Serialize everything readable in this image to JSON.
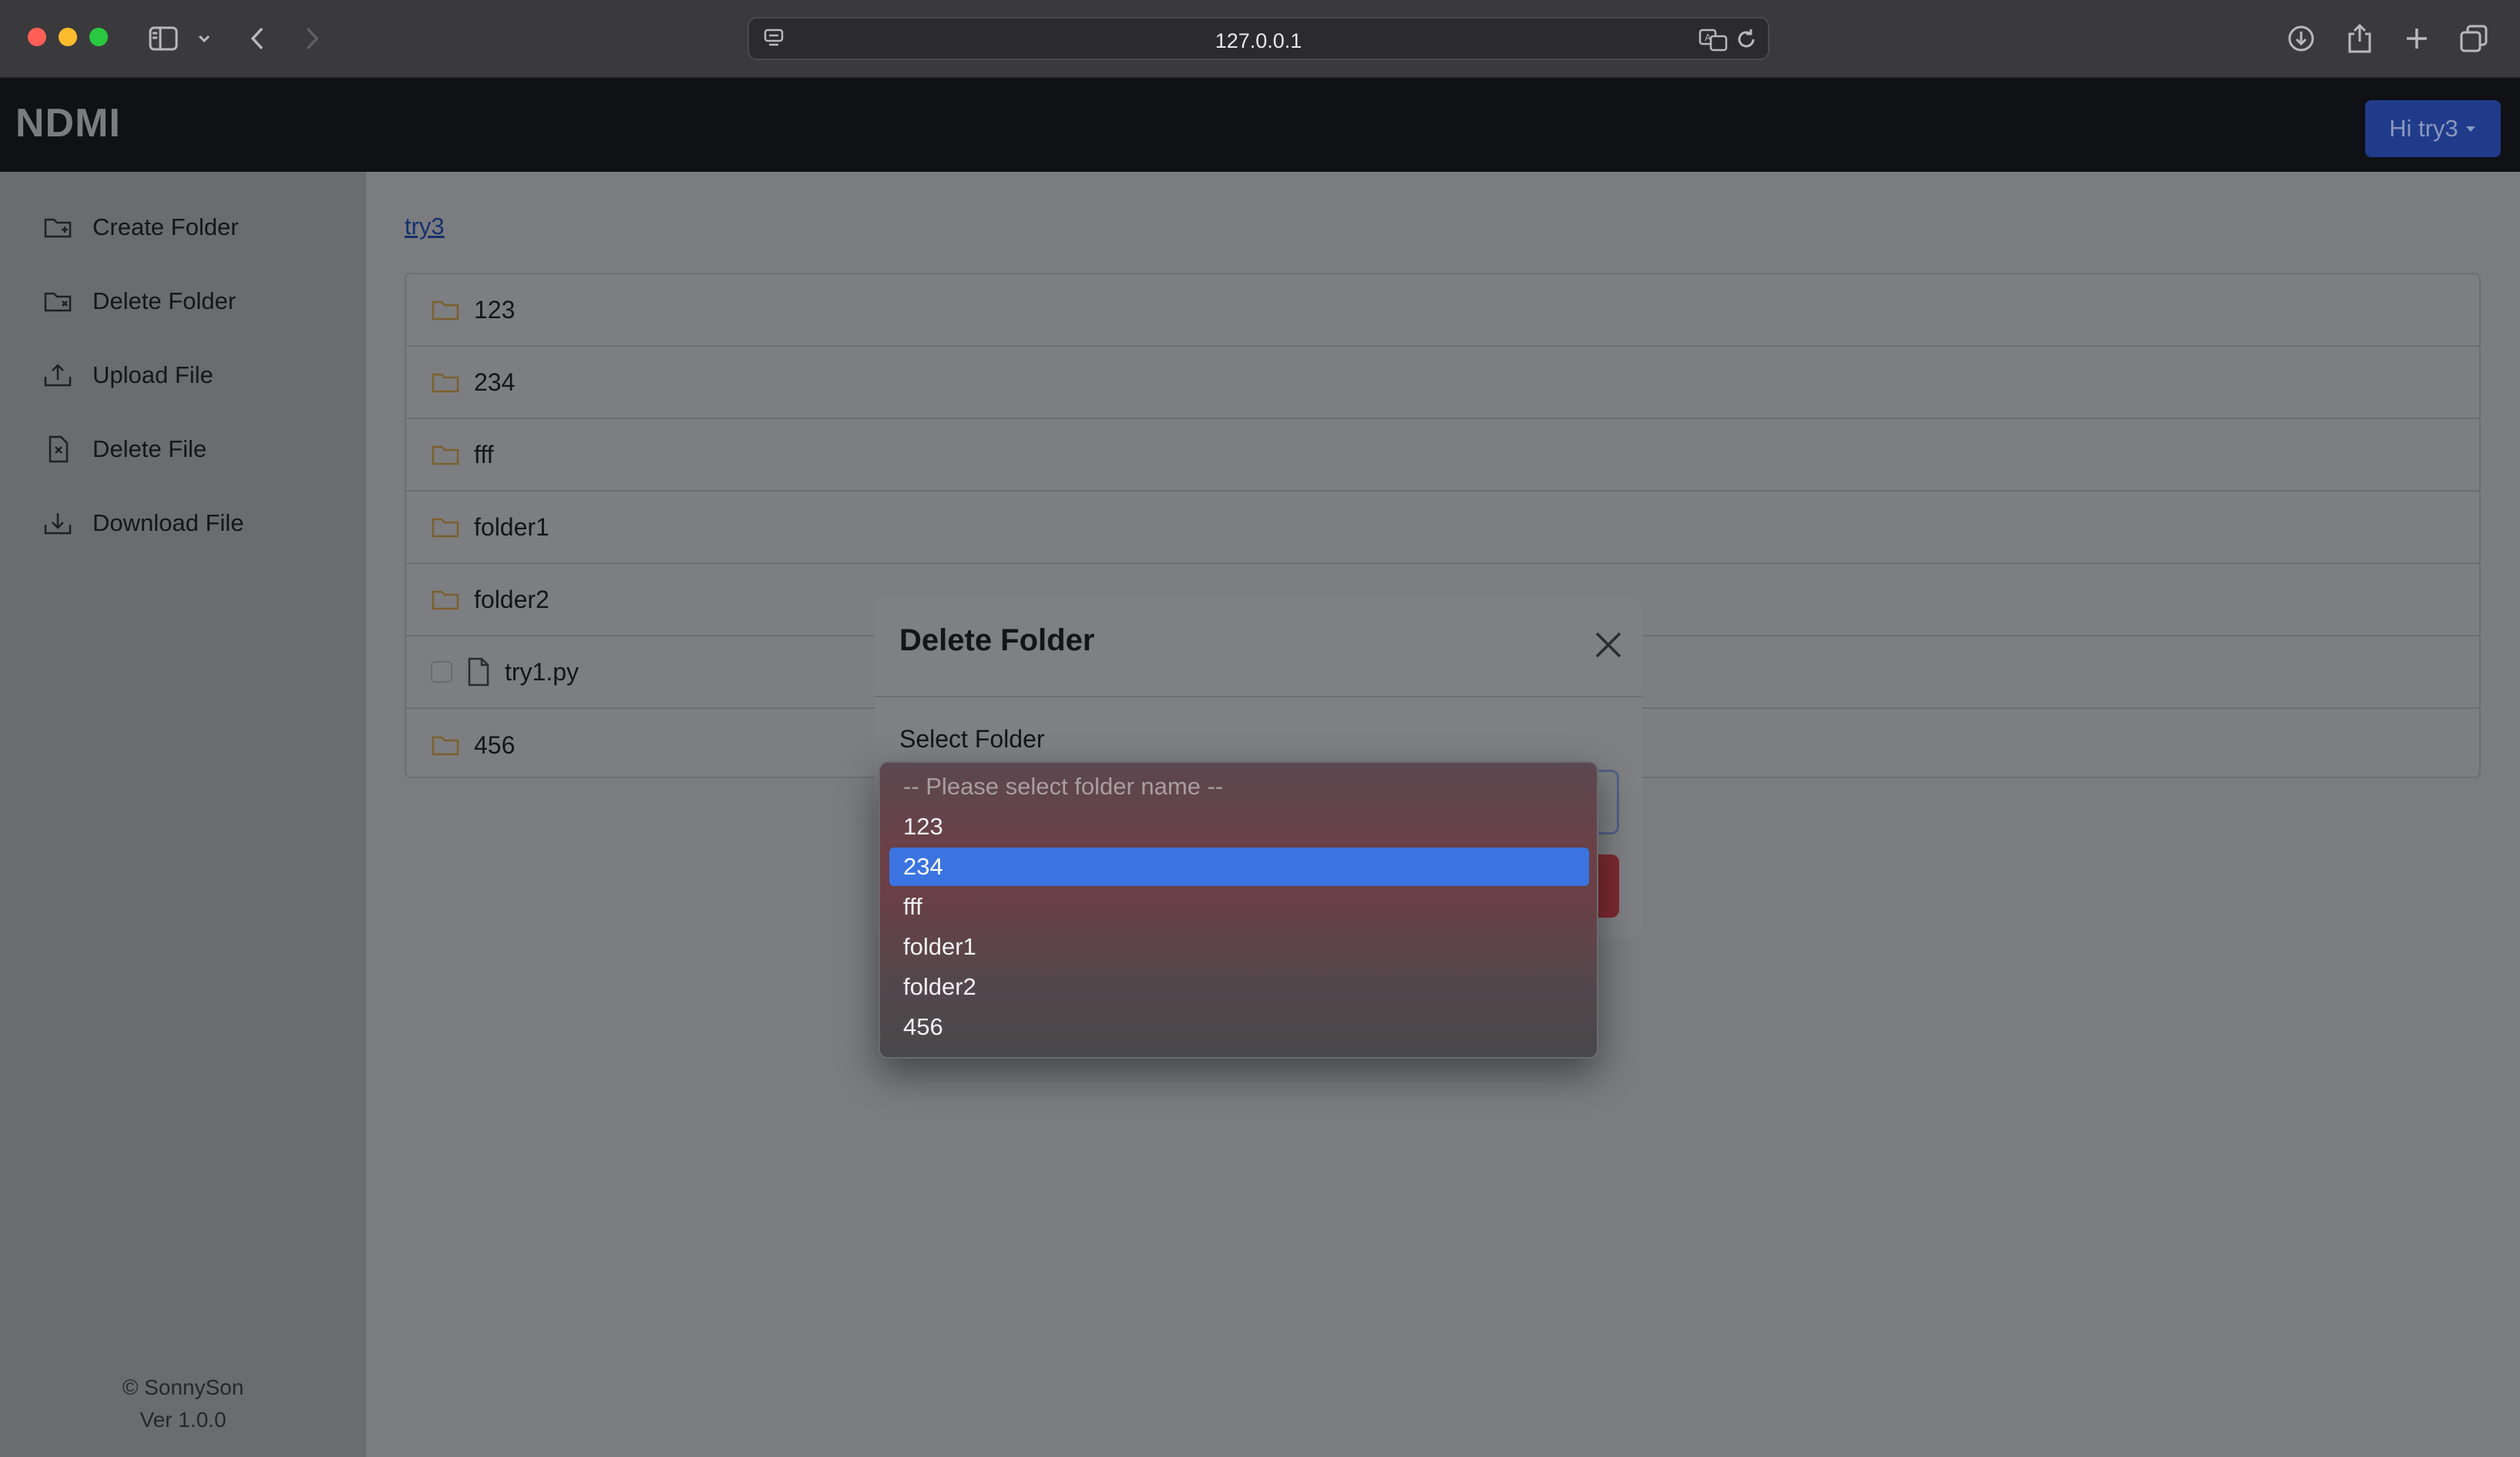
{
  "browser": {
    "url": "127.0.0.1"
  },
  "app": {
    "brand": "NDMI",
    "user_menu_label": "Hi try3"
  },
  "sidebar": {
    "items": [
      {
        "label": "Create Folder",
        "icon": "folder-plus-icon"
      },
      {
        "label": "Delete Folder",
        "icon": "folder-x-icon"
      },
      {
        "label": "Upload File",
        "icon": "upload-icon"
      },
      {
        "label": "Delete File",
        "icon": "file-x-icon"
      },
      {
        "label": "Download File",
        "icon": "download-icon"
      }
    ],
    "footer": {
      "copyright": "© SonnySon",
      "version": "Ver 1.0.0"
    }
  },
  "main": {
    "breadcrumb": "try3",
    "entries": [
      {
        "name": "123",
        "type": "folder"
      },
      {
        "name": "234",
        "type": "folder"
      },
      {
        "name": "fff",
        "type": "folder"
      },
      {
        "name": "folder1",
        "type": "folder"
      },
      {
        "name": "folder2",
        "type": "folder"
      },
      {
        "name": "try1.py",
        "type": "file"
      },
      {
        "name": "456",
        "type": "folder"
      }
    ]
  },
  "modal": {
    "title": "Delete Folder",
    "field_label": "Select Folder",
    "dropdown": {
      "placeholder": "-- Please select folder name --",
      "options": [
        "123",
        "234",
        "fff",
        "folder1",
        "folder2",
        "456"
      ],
      "highlighted": "234"
    }
  },
  "colors": {
    "user_button": "#1f3b8a",
    "highlight": "#3b74e0",
    "delete_button": "#7d2a31"
  }
}
